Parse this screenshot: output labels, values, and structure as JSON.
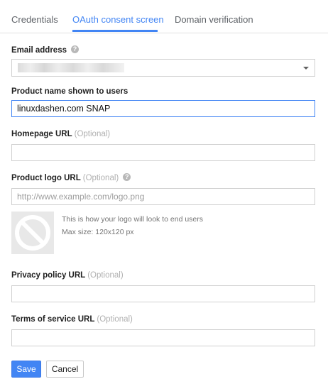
{
  "tabs": [
    {
      "label": "Credentials",
      "active": false
    },
    {
      "label": "OAuth consent screen",
      "active": true
    },
    {
      "label": "Domain verification",
      "active": false
    }
  ],
  "form": {
    "email": {
      "label": "Email address",
      "help_icon": "question-mark-icon"
    },
    "product_name": {
      "label": "Product name shown to users",
      "value": "linuxdashen.com SNAP"
    },
    "homepage": {
      "label": "Homepage URL",
      "optional": "(Optional)",
      "value": ""
    },
    "logo": {
      "label": "Product logo URL",
      "optional": "(Optional)",
      "placeholder": "http://www.example.com/logo.png",
      "help_icon": "question-mark-icon",
      "preview_icon": "no-image-icon",
      "hint": "This is how your logo will look to end users",
      "max_size": "Max size: 120x120 px"
    },
    "privacy": {
      "label": "Privacy policy URL",
      "optional": "(Optional)",
      "value": ""
    },
    "terms": {
      "label": "Terms of service URL",
      "optional": "(Optional)",
      "value": ""
    }
  },
  "buttons": {
    "save": "Save",
    "cancel": "Cancel"
  },
  "colors": {
    "accent": "#4285f4",
    "muted_text": "#9e9e9e",
    "border": "#d0d0d0"
  }
}
